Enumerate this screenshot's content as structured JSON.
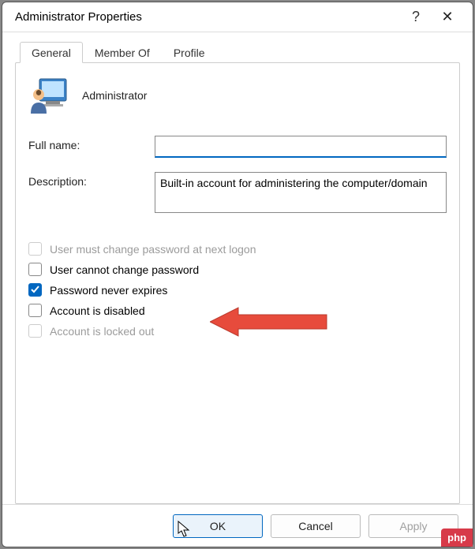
{
  "window": {
    "title": "Administrator Properties",
    "help_glyph": "?",
    "close_glyph": "✕"
  },
  "tabs": [
    {
      "label": "General",
      "active": true
    },
    {
      "label": "Member Of",
      "active": false
    },
    {
      "label": "Profile",
      "active": false
    }
  ],
  "account_name": "Administrator",
  "fields": {
    "full_name_label": "Full name:",
    "full_name_value": "",
    "description_label": "Description:",
    "description_value": "Built-in account for administering the computer/domain"
  },
  "checkboxes": [
    {
      "key": "must_change",
      "label": "User must change password at next logon",
      "checked": false,
      "enabled": false
    },
    {
      "key": "cannot_change",
      "label": "User cannot change password",
      "checked": false,
      "enabled": true
    },
    {
      "key": "never_expires",
      "label": "Password never expires",
      "checked": true,
      "enabled": true
    },
    {
      "key": "disabled",
      "label": "Account is disabled",
      "checked": false,
      "enabled": true
    },
    {
      "key": "locked_out",
      "label": "Account is locked out",
      "checked": false,
      "enabled": false
    }
  ],
  "buttons": {
    "ok": "OK",
    "cancel": "Cancel",
    "apply": "Apply"
  },
  "annotation": {
    "arrow_color": "#e74b3c"
  },
  "watermark": "php"
}
